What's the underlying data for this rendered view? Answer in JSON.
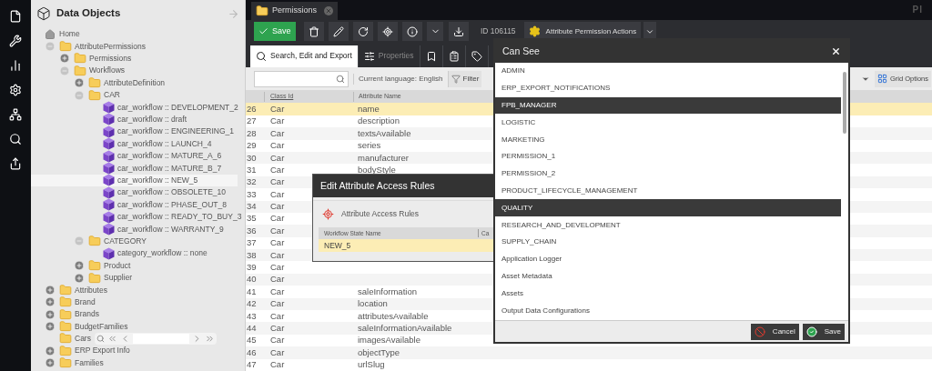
{
  "app_bar": {
    "logo_text": "PI"
  },
  "sidebar": {
    "title": "Data Objects",
    "tree": [
      {
        "label": "Home",
        "kind": "home",
        "selected": false
      },
      {
        "label": "AttributePermissions",
        "kind": "folder",
        "expanded": true,
        "selected": false,
        "children": [
          {
            "label": "Permissions",
            "kind": "folder",
            "expanded": false,
            "selected": false
          },
          {
            "label": "Workflows",
            "kind": "folder",
            "expanded": true,
            "selected": false,
            "children": [
              {
                "label": "AttributeDefinition",
                "kind": "folder",
                "expanded": false,
                "selected": false
              },
              {
                "label": "CAR",
                "kind": "folder",
                "expanded": true,
                "selected": false,
                "children": [
                  {
                    "label": "car_workflow :: DEVELOPMENT_2",
                    "kind": "workflow",
                    "selected": false
                  },
                  {
                    "label": "car_workflow :: draft",
                    "kind": "workflow",
                    "selected": false
                  },
                  {
                    "label": "car_workflow :: ENGINEERING_1",
                    "kind": "workflow",
                    "selected": false
                  },
                  {
                    "label": "car_workflow :: LAUNCH_4",
                    "kind": "workflow",
                    "selected": false
                  },
                  {
                    "label": "car_workflow :: MATURE_A_6",
                    "kind": "workflow",
                    "selected": false
                  },
                  {
                    "label": "car_workflow :: MATURE_B_7",
                    "kind": "workflow",
                    "selected": false
                  },
                  {
                    "label": "car_workflow :: NEW_5",
                    "kind": "workflow",
                    "selected": true
                  },
                  {
                    "label": "car_workflow :: OBSOLETE_10",
                    "kind": "workflow",
                    "selected": false
                  },
                  {
                    "label": "car_workflow :: PHASE_OUT_8",
                    "kind": "workflow",
                    "selected": false
                  },
                  {
                    "label": "car_workflow :: READY_TO_BUY_3",
                    "kind": "workflow",
                    "selected": false
                  },
                  {
                    "label": "car_workflow :: WARRANTY_9",
                    "kind": "workflow",
                    "selected": false
                  }
                ]
              },
              {
                "label": "CATEGORY",
                "kind": "folder",
                "expanded": true,
                "selected": false,
                "children": [
                  {
                    "label": "category_workflow :: none",
                    "kind": "workflow",
                    "selected": false
                  }
                ]
              },
              {
                "label": "Product",
                "kind": "folder",
                "expanded": false,
                "selected": false
              },
              {
                "label": "Supplier",
                "kind": "folder",
                "expanded": false,
                "selected": false
              }
            ]
          }
        ]
      },
      {
        "label": "Attributes",
        "kind": "folder",
        "expanded": false,
        "selected": false
      },
      {
        "label": "Brand",
        "kind": "folder",
        "expanded": false,
        "selected": false
      },
      {
        "label": "Brands",
        "kind": "folder",
        "expanded": false,
        "selected": false
      },
      {
        "label": "BudgetFamilies",
        "kind": "folder",
        "expanded": false,
        "selected": false
      },
      {
        "label": "Cars",
        "kind": "folder",
        "selected": false,
        "pager": true
      },
      {
        "label": "ERP Export Info",
        "kind": "folder",
        "expanded": false,
        "selected": false
      },
      {
        "label": "Families",
        "kind": "folder",
        "expanded": false,
        "selected": false
      }
    ]
  },
  "document_tab": {
    "title": "Permissions"
  },
  "toolbar": {
    "save": "Save",
    "id_text": "ID 106115",
    "actions": "Attribute Permission Actions"
  },
  "tabs": [
    {
      "label": "Search, Edit and Export",
      "selected": true
    },
    {
      "label": "Properties",
      "selected": false
    },
    {
      "selected": false
    },
    {
      "selected": false
    },
    {
      "selected": false
    }
  ],
  "filter_bar": {
    "language": "Current language: English",
    "filter": "Filter",
    "grid_options": "Grid Options"
  },
  "table": {
    "columns": [
      "Class Id",
      "Attribute Name"
    ],
    "rows": [
      {
        "number": "26",
        "class_id": "Car",
        "attribute_name": "name",
        "selected": true
      },
      {
        "number": "27",
        "class_id": "Car",
        "attribute_name": "description",
        "selected": false
      },
      {
        "number": "28",
        "class_id": "Car",
        "attribute_name": "textsAvailable",
        "selected": false
      },
      {
        "number": "29",
        "class_id": "Car",
        "attribute_name": "series",
        "selected": false
      },
      {
        "number": "30",
        "class_id": "Car",
        "attribute_name": "manufacturer",
        "selected": false
      },
      {
        "number": "31",
        "class_id": "Car",
        "attribute_name": "bodyStyle",
        "selected": false
      },
      {
        "number": "32",
        "class_id": "Car",
        "selected": false
      },
      {
        "number": "33",
        "class_id": "Car",
        "selected": false
      },
      {
        "number": "34",
        "class_id": "Car",
        "selected": false
      },
      {
        "number": "35",
        "class_id": "Car",
        "selected": false
      },
      {
        "number": "36",
        "class_id": "Car",
        "selected": false
      },
      {
        "number": "37",
        "class_id": "Car",
        "selected": false
      },
      {
        "number": "38",
        "class_id": "Car",
        "selected": false
      },
      {
        "number": "39",
        "class_id": "Car",
        "selected": false
      },
      {
        "number": "40",
        "class_id": "Car",
        "selected": false
      },
      {
        "number": "41",
        "class_id": "Car",
        "attribute_name": "saleInformation",
        "selected": false
      },
      {
        "number": "42",
        "class_id": "Car",
        "attribute_name": "location",
        "selected": false
      },
      {
        "number": "43",
        "class_id": "Car",
        "attribute_name": "attributesAvailable",
        "selected": false
      },
      {
        "number": "44",
        "class_id": "Car",
        "attribute_name": "saleInformationAvailable",
        "selected": false
      },
      {
        "number": "45",
        "class_id": "Car",
        "attribute_name": "imagesAvailable",
        "selected": false
      },
      {
        "number": "46",
        "class_id": "Car",
        "attribute_name": "objectType",
        "selected": false
      },
      {
        "number": "47",
        "class_id": "Car",
        "attribute_name": "urlSlug",
        "selected": false
      }
    ]
  },
  "edit_dialog": {
    "title": "Edit Attribute Access Rules",
    "section": "Attribute Access Rules",
    "columns": [
      "Workflow State Name",
      "Ca"
    ],
    "rows": [
      {
        "state": "NEW_5",
        "selected": true
      }
    ]
  },
  "can_see_dialog": {
    "title": "Can See",
    "items": [
      {
        "label": "ADMIN",
        "selected": false
      },
      {
        "label": "ERP_EXPORT_NOTIFICATIONS",
        "selected": false
      },
      {
        "label": "FPB_MANAGER",
        "selected": true
      },
      {
        "label": "LOGISTIC",
        "selected": false
      },
      {
        "label": "MARKETING",
        "selected": false
      },
      {
        "label": "PERMISSION_1",
        "selected": false
      },
      {
        "label": "PERMISSION_2",
        "selected": false
      },
      {
        "label": "PRODUCT_LIFECYCLE_MANAGEMENT",
        "selected": false
      },
      {
        "label": "QUALITY",
        "selected": true
      },
      {
        "label": "RESEARCH_AND_DEVELOPMENT",
        "selected": false
      },
      {
        "label": "SUPPLY_CHAIN",
        "selected": false
      },
      {
        "label": "Application Logger",
        "selected": false
      },
      {
        "label": "Asset Metadata",
        "selected": false
      },
      {
        "label": "Assets",
        "selected": false
      },
      {
        "label": "Output Data Configurations",
        "selected": false
      }
    ],
    "cancel": "Cancel",
    "save": "Save"
  }
}
